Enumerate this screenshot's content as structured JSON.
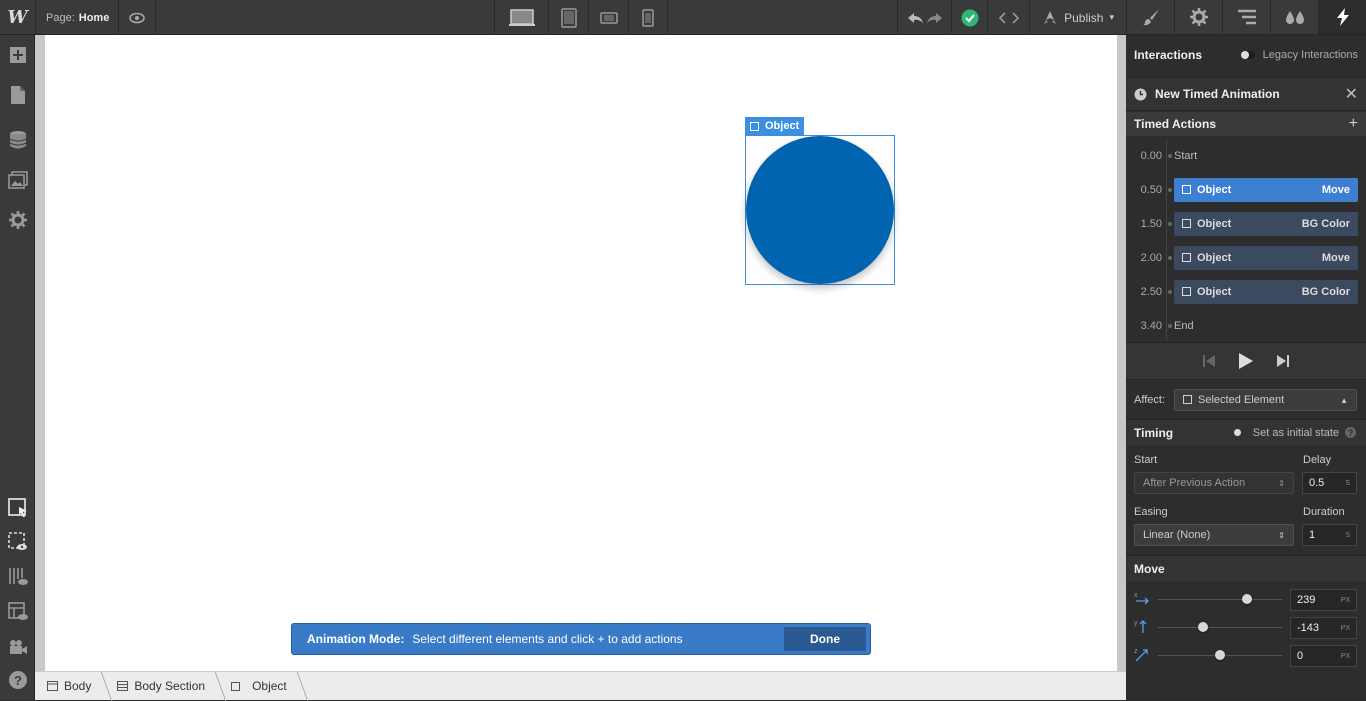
{
  "topbar": {
    "logo": "W",
    "page_label": "Page:",
    "page_name": "Home",
    "publish_label": "Publish"
  },
  "canvas": {
    "object_tag": "Object",
    "circle_color": "#0064b0"
  },
  "animation_mode": {
    "label": "Animation Mode:",
    "message": "Select different elements and click + to add actions",
    "done_label": "Done"
  },
  "breadcrumbs": [
    "Body",
    "Body Section",
    "Object"
  ],
  "panel": {
    "interactions_title": "Interactions",
    "legacy_label": "Legacy Interactions",
    "animation_title": "New Timed Animation",
    "timed_actions_title": "Timed Actions",
    "timeline": [
      {
        "time": "0.00",
        "label": "Start"
      },
      {
        "time": "0.50",
        "target": "Object",
        "action": "Move"
      },
      {
        "time": "1.50",
        "target": "Object",
        "action": "BG Color"
      },
      {
        "time": "2.00",
        "target": "Object",
        "action": "Move"
      },
      {
        "time": "2.50",
        "target": "Object",
        "action": "BG Color"
      },
      {
        "time": "3.40",
        "label": "End"
      }
    ],
    "affect_label": "Affect:",
    "affect_value": "Selected Element",
    "timing_title": "Timing",
    "initial_state_label": "Set as initial state",
    "start_label": "Start",
    "start_value": "After Previous Action",
    "delay_label": "Delay",
    "delay_value": "0.5",
    "delay_unit": "S",
    "easing_label": "Easing",
    "easing_value": "Linear (None)",
    "duration_label": "Duration",
    "duration_value": "1",
    "duration_unit": "S",
    "move_title": "Move",
    "move_x": "239",
    "move_y": "-143",
    "move_z": "0",
    "move_unit": "PX"
  }
}
